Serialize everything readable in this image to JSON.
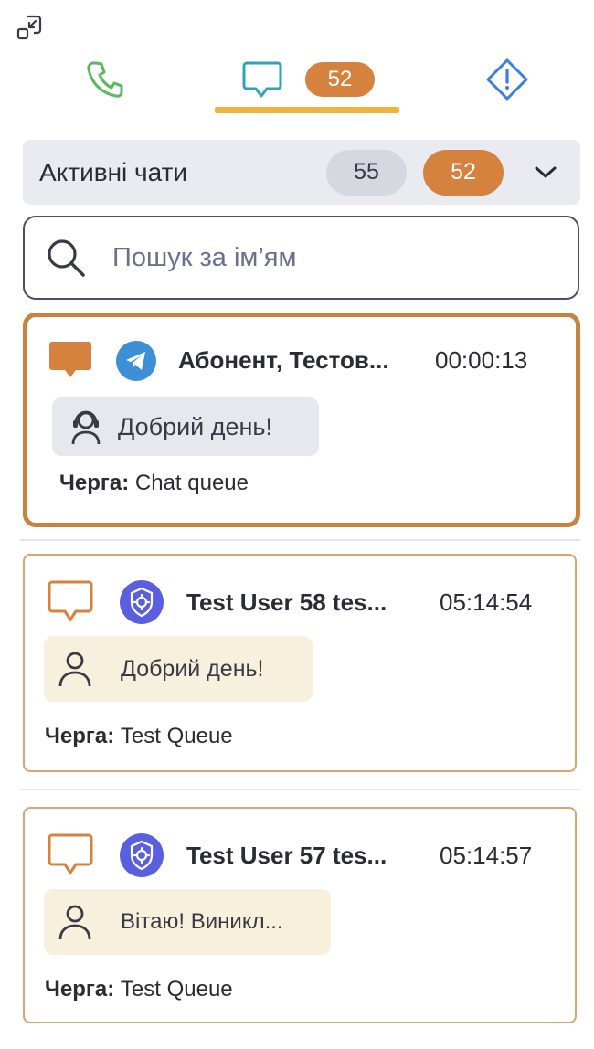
{
  "header": {
    "collapse_icon": "minimize-icon"
  },
  "tabs": [
    {
      "name": "calls",
      "icon": "phone-icon",
      "color": "#5cb85c"
    },
    {
      "name": "chats",
      "icon": "chat-bubble-icon",
      "color": "#2aa6b8",
      "badge": "52",
      "active": true
    },
    {
      "name": "alerts",
      "icon": "warning-diamond-icon",
      "color": "#3b7de0"
    }
  ],
  "filter": {
    "title": "Активні чати",
    "total_count": "55",
    "active_count": "52"
  },
  "search": {
    "placeholder": "Пошук за ім’ям"
  },
  "chats": [
    {
      "name": "Абонент, Тестов...",
      "time": "00:00:13",
      "channel": "telegram",
      "message": "Добрий день!",
      "message_author": "agent",
      "queue_label": "Черга:",
      "queue": "Chat queue",
      "selected": true
    },
    {
      "name": "Test User 58 tes...",
      "time": "05:14:54",
      "channel": "webchat",
      "message": "Добрий день!",
      "message_author": "client",
      "queue_label": "Черга:",
      "queue": "Test Queue"
    },
    {
      "name": "Test User 57 tes...",
      "time": "05:14:57",
      "channel": "webchat",
      "message": "Вітаю! Виникл...",
      "message_author": "client",
      "queue_label": "Черга:",
      "queue": "Test Queue"
    }
  ],
  "colors": {
    "accent_orange": "#d4823d",
    "tab_underline": "#f0b43c",
    "chat_teal": "#2aa6b8",
    "webchat_blue": "#5a5fe0",
    "telegram_blue": "#3d8fd6"
  }
}
